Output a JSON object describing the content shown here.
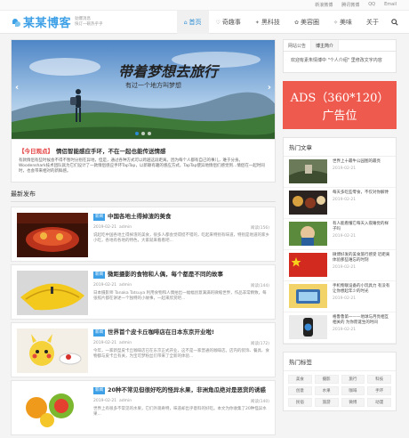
{
  "topbar": {
    "links": [
      "新浪微博",
      "腾讯微博",
      "QQ",
      "Email"
    ]
  },
  "logo": {
    "text": "某某博客",
    "sub1": "劲爆消息",
    "sub2": "快订一碗热乎乎"
  },
  "nav": {
    "items": [
      {
        "label": "首页",
        "icon": "home-icon",
        "glyph": "⌂",
        "active": true
      },
      {
        "label": "奇趣事",
        "icon": "heart-icon",
        "glyph": "♡",
        "active": false
      },
      {
        "label": "黑科技",
        "icon": "bolt-icon",
        "glyph": "✦",
        "active": false
      },
      {
        "label": "美容圈",
        "icon": "flower-icon",
        "glyph": "✿",
        "active": false
      },
      {
        "label": "美味",
        "icon": "star-icon",
        "glyph": "✧",
        "active": false
      },
      {
        "label": "关于",
        "icon": "info-icon",
        "glyph": "",
        "active": false
      }
    ]
  },
  "banner": {
    "calligraphy": "带着梦想去旅行",
    "tagline": "有过一个地方叫梦想",
    "prev": "‹",
    "next": "›"
  },
  "headline": {
    "tag": "【今日观点】",
    "title": "情侣智能感应手环，不在一起也能传送情感",
    "text": "有款情侣有些时候会不得不暂时分别在异地，但是，通过各种方式可以跨越这段距离。因为每个人都有自己的事儿，难于分身。Woodenshark技术团队就为它们设计了一款情侣感应手环TapTap，以新颖有趣的感应方式，TapTap使异地情侣们感觉到...情侣在一起时同时，也会带来相对的新鲜感。"
  },
  "latest": {
    "title": "最新发布"
  },
  "posts": [
    {
      "cat": "新闻",
      "title": "中国各地土得掉渣的美食",
      "date": "2019-02-21",
      "author": "admin",
      "views": "阅读(156)",
      "excerpt": "说起吃中国各地土得掉渣的美食，很多人都会觉得挺不错的，吃起来特别有味道，特别是地道的家乡小吃，各地有各地的特色，大家就来看看吧..."
    },
    {
      "cat": "新闻",
      "title": "微距摄影的食物和人偶，每个都是不同的故事",
      "date": "2019-02-21",
      "author": "admin",
      "views": "阅读(144)",
      "excerpt": "日本摄影师 Tanaka Tatsuya 利用食物和人偶拍出一幅幅创意满满的微缩世界，作品非常精致，每张照片都在讲述一个独特的小故事，一起来欣赏吧..."
    },
    {
      "cat": "新闻",
      "title": "世界首个皮卡丘咖啡店在日本东京开业啦!",
      "date": "2019-02-21",
      "author": "admin",
      "views": "阅读(172)",
      "excerpt": "今年，一家新型皮卡丘咖啡店已在东京正式开业，这不是一家普通的咖啡店。店内的装饰、餐具、食物都与皮卡丘有关，为宝可梦粉丝们带来了全新的体验..."
    },
    {
      "cat": "新闻",
      "title": "20种不常见但很好吃的怪异水果，非洲角瓜绝对是恶货的诱惑",
      "date": "2019-02-21",
      "author": "admin",
      "views": "阅读(140)",
      "excerpt": "世界上有很多不常见的水果，它们外观奇特，味道却出乎意料的好吃。本文为你收集了20种怪异水果..."
    }
  ],
  "sidebar": {
    "tabs": [
      "网站公告",
      "博主简介"
    ],
    "notice": "欢迎有素朱情博中 \"个人介绍\" 里修改文字内容",
    "ads": {
      "line1": "ADS（360*120）",
      "line2": "广告位"
    },
    "hot_title": "热门文章",
    "hot": [
      {
        "title": "世界上十最牛公园图的最亮",
        "date": "2019-02-21"
      },
      {
        "title": "每天多吃些零食，不仅对你解馋",
        "date": "2019-02-21"
      },
      {
        "title": "有人能看懂它每天入夜睡觉的样子吗",
        "date": "2019-02-21"
      },
      {
        "title": "微博好发的美食旅行感受 近距离体验那些难忘的时刻",
        "date": "2019-02-21"
      },
      {
        "title": "手机物联设备的小玩具力 有没有让你想起年少的时光",
        "date": "2019-02-21"
      },
      {
        "title": "格鲁鲁第一——地球与月亮相互相关的 为你而诞生的时间",
        "date": "2019-02-21"
      }
    ],
    "tags_title": "热门标签",
    "tags": [
      "美食",
      "摄影",
      "旅行",
      "科技",
      "创意",
      "水果",
      "咖啡",
      "手环",
      "民宿",
      "旅游",
      "微博",
      "动漫"
    ]
  }
}
